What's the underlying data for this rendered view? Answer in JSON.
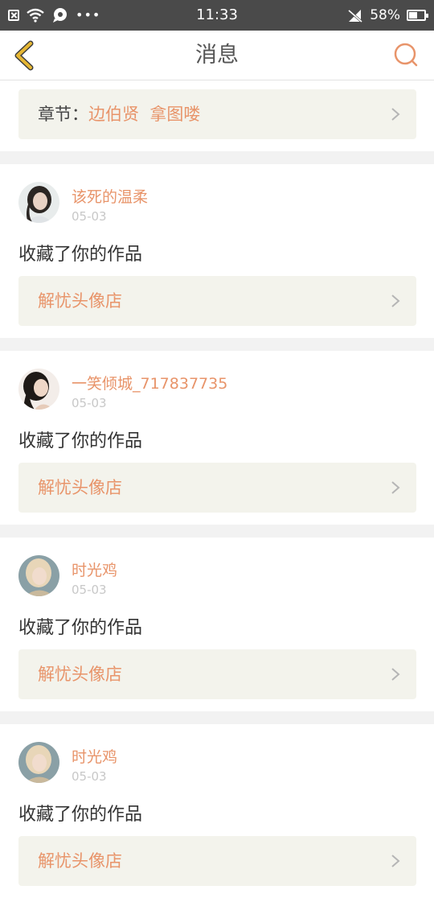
{
  "status_bar": {
    "time": "11:33",
    "battery_percent": "58%",
    "battery_level": 0.58,
    "dots": "•••",
    "icons": [
      "close-notification-icon",
      "wifi-icon",
      "chat-bubble-icon",
      "no-signal-icon",
      "battery-icon"
    ]
  },
  "nav": {
    "title": "消息",
    "back_icon": "chevron-left-icon",
    "search_icon": "search-icon"
  },
  "chapter": {
    "prefix": "章节：",
    "names": "边伯贤  拿图喽"
  },
  "messages": [
    {
      "username": "该死的温柔",
      "date": "05-03",
      "action": "收藏了你的作品",
      "link": "解忧头像店"
    },
    {
      "username": "一笑倾城_717837735",
      "date": "05-03",
      "action": "收藏了你的作品",
      "link": "解忧头像店"
    },
    {
      "username": "时光鸡",
      "date": "05-03",
      "action": "收藏了你的作品",
      "link": "解忧头像店"
    },
    {
      "username": "时光鸡",
      "date": "05-03",
      "action": "收藏了你的作品",
      "link": "解忧头像店"
    }
  ],
  "colors": {
    "accent": "#e8946a",
    "status_bar": "#4a4a4a",
    "back_icon": "#d9a62a",
    "link_box": "#f3f3ec",
    "page_bg": "#f2f2f2"
  }
}
